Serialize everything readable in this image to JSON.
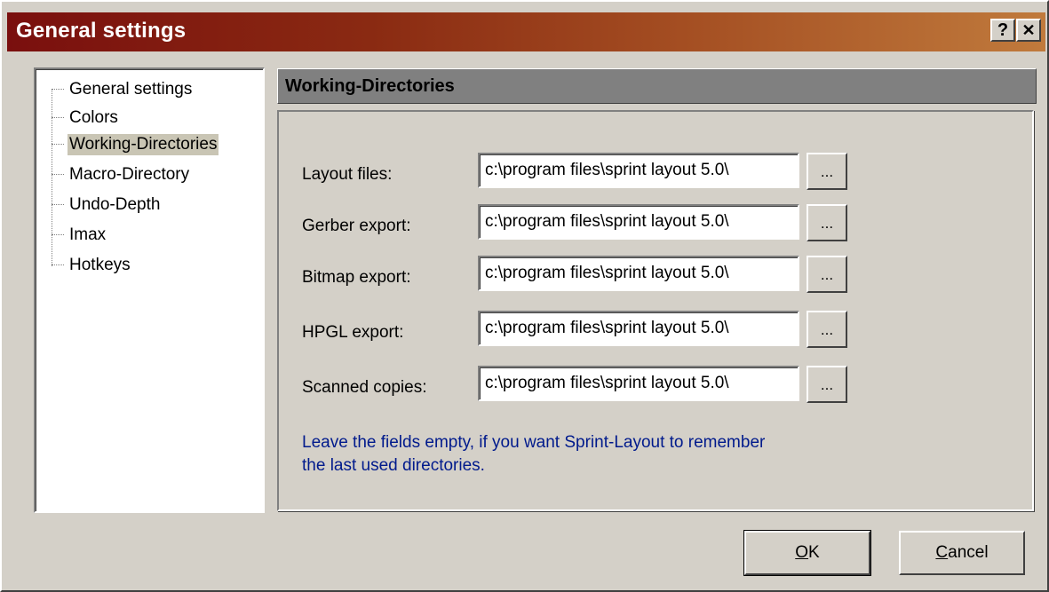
{
  "window": {
    "title": "General settings",
    "help_glyph": "?",
    "close_glyph": "✕"
  },
  "tree": {
    "items": [
      {
        "label": "General settings"
      },
      {
        "label": "Colors"
      },
      {
        "label": "Working-Directories",
        "selected": true
      },
      {
        "label": "Macro-Directory"
      },
      {
        "label": "Undo-Depth"
      },
      {
        "label": "Imax"
      },
      {
        "label": "Hotkeys"
      }
    ]
  },
  "panel": {
    "header": "Working-Directories",
    "rows": [
      {
        "label": "Layout files:",
        "value": "c:\\program files\\sprint layout 5.0\\",
        "browse": "..."
      },
      {
        "label": "Gerber export:",
        "value": "c:\\program files\\sprint layout 5.0\\",
        "browse": "..."
      },
      {
        "label": "Bitmap export:",
        "value": "c:\\program files\\sprint layout 5.0\\",
        "browse": "..."
      },
      {
        "label": "HPGL export:",
        "value": "c:\\program files\\sprint layout 5.0\\",
        "browse": "..."
      },
      {
        "label": "Scanned copies:",
        "value": "c:\\program files\\sprint layout 5.0\\",
        "browse": "..."
      }
    ],
    "hint": {
      "line1": "Leave the fields empty, if you want Sprint-Layout to remember",
      "line2": "the last used directories."
    }
  },
  "buttons": {
    "ok_mnemonic": "O",
    "ok_rest": "K",
    "cancel_mnemonic": "C",
    "cancel_rest": "ancel"
  },
  "colors": {
    "title_start": "#7a0f0e",
    "title_end": "#c07a3c",
    "hint_text": "#001a8c",
    "header_bg": "#808080"
  }
}
